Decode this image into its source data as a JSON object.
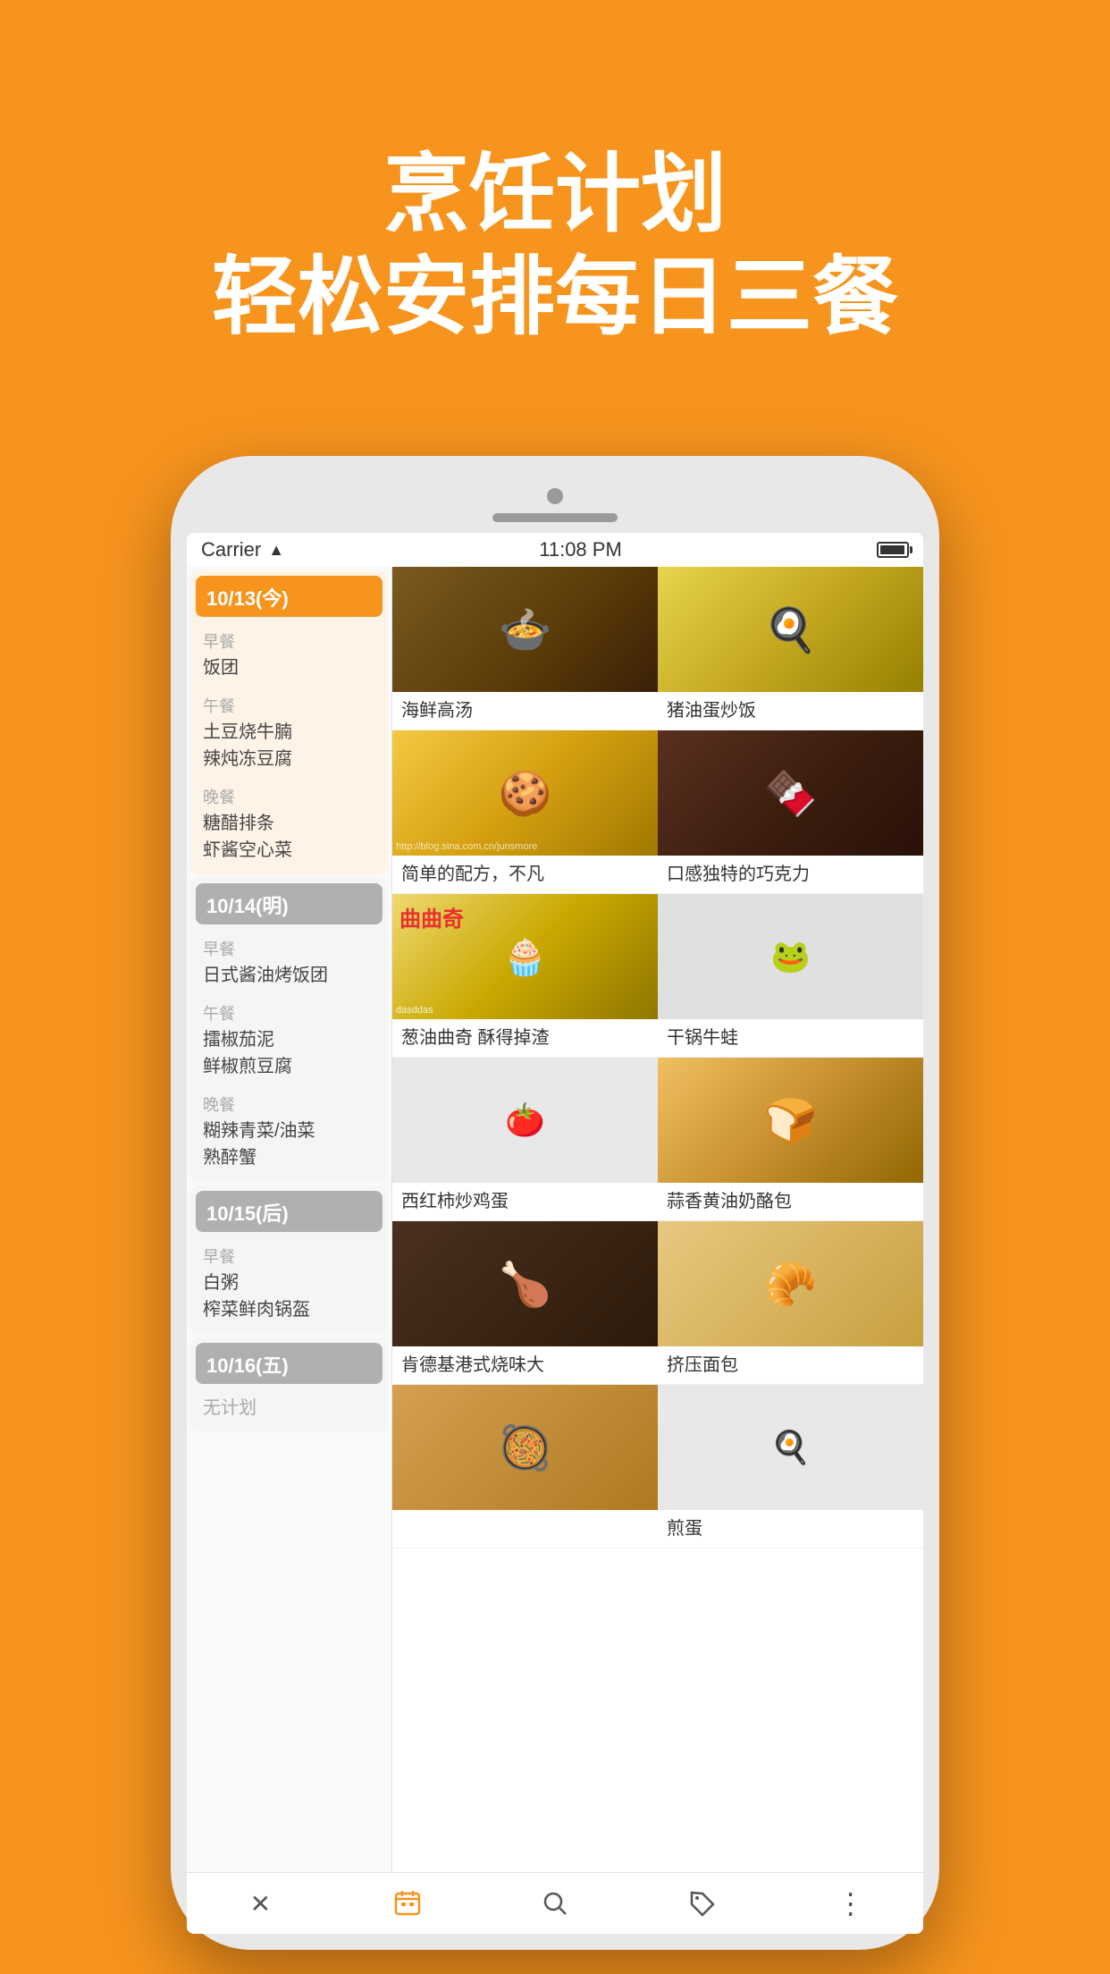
{
  "app": {
    "header": {
      "line1": "烹饪计划",
      "line2": "轻松安排每日三餐"
    },
    "status_bar": {
      "carrier": "Carrier",
      "time": "11:08 PM"
    },
    "days": [
      {
        "id": "today",
        "label": "10/13(今)",
        "type": "today",
        "meals": [
          {
            "type": "早餐",
            "items": [
              "饭团"
            ]
          },
          {
            "type": "午餐",
            "items": [
              "土豆烧牛腩",
              "辣炖冻豆腐"
            ]
          },
          {
            "type": "晚餐",
            "items": [
              "糖醋排条",
              "虾酱空心菜"
            ]
          }
        ]
      },
      {
        "id": "tomorrow",
        "label": "10/14(明)",
        "type": "tomorrow",
        "meals": [
          {
            "type": "早餐",
            "items": [
              "日式酱油烤饭团"
            ]
          },
          {
            "type": "午餐",
            "items": [
              "擂椒茄泥",
              "鲜椒煎豆腐"
            ]
          },
          {
            "type": "晚餐",
            "items": [
              "糊辣青菜/油菜",
              "熟醉蟹"
            ]
          }
        ]
      },
      {
        "id": "day3",
        "label": "10/15(后)",
        "type": "later",
        "meals": [
          {
            "type": "早餐",
            "items": [
              "白粥",
              "榨菜鲜肉锅盔"
            ]
          }
        ]
      },
      {
        "id": "day4",
        "label": "10/16(五)",
        "type": "weekday",
        "no_plan": "无计划"
      }
    ],
    "recipes": [
      {
        "id": "r1",
        "name": "海鲜高汤",
        "food_class": "food-seafood",
        "has_image": true,
        "overlay": ""
      },
      {
        "id": "r2",
        "name": "猪油蛋炒饭",
        "food_class": "food-eggrice",
        "has_image": true,
        "overlay": ""
      },
      {
        "id": "r3",
        "name": "简单的配方，不凡",
        "food_class": "food-cookies-y",
        "has_image": true,
        "overlay": "http://blog.sina.com.cn/junsmore"
      },
      {
        "id": "r4",
        "name": "口感独特的巧克力",
        "food_class": "food-cookies-d",
        "has_image": true,
        "overlay": ""
      },
      {
        "id": "r5",
        "name": "葱油曲奇 酥得掉渣",
        "food_class": "food-scallion",
        "has_image": true,
        "overlay_top": "曲曲奇"
      },
      {
        "id": "r6",
        "name": "干锅牛蛙",
        "food_class": "food-frog",
        "has_image": false,
        "overlay": ""
      },
      {
        "id": "r7",
        "name": "西红柿炒鸡蛋",
        "food_class": "food-tomato-egg",
        "has_image": false,
        "overlay": ""
      },
      {
        "id": "r8",
        "name": "蒜香黄油奶酪包",
        "food_class": "food-bread-oven",
        "has_image": true,
        "overlay": ""
      },
      {
        "id": "r9",
        "name": "肯德基港式烧味大",
        "food_class": "food-kfc",
        "has_image": true,
        "overlay": ""
      },
      {
        "id": "r10",
        "name": "挤压面包",
        "food_class": "food-bread",
        "has_image": true,
        "overlay": ""
      },
      {
        "id": "r11",
        "name": "",
        "food_class": "food-bowl",
        "has_image": true,
        "overlay": ""
      },
      {
        "id": "r12",
        "name": "煎蛋",
        "food_class": "food-egg",
        "has_image": false,
        "overlay": ""
      }
    ],
    "bottom_nav": [
      {
        "id": "close",
        "icon": "✕",
        "label": "close"
      },
      {
        "id": "calendar",
        "icon": "📅",
        "label": "calendar"
      },
      {
        "id": "search",
        "icon": "🔍",
        "label": "search"
      },
      {
        "id": "tag",
        "icon": "🏷",
        "label": "tag"
      },
      {
        "id": "more",
        "icon": "⋮",
        "label": "more"
      }
    ]
  }
}
